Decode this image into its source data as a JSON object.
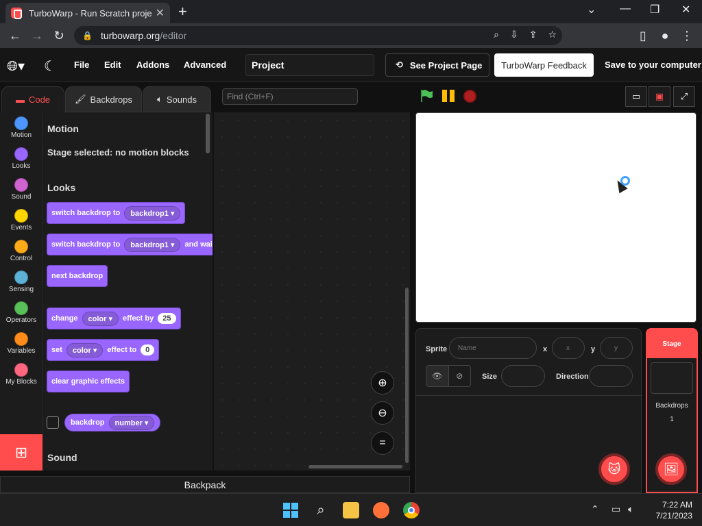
{
  "browser": {
    "tab_title": "TurboWarp - Run Scratch projects",
    "url_host": "turbowarp.org",
    "url_path": "/editor"
  },
  "menubar": {
    "file": "File",
    "edit": "Edit",
    "addons": "Addons",
    "advanced": "Advanced",
    "project_title": "Project",
    "see_project_page": "See Project Page",
    "feedback": "TurboWarp Feedback",
    "save": "Save to your computer"
  },
  "editor_tabs": {
    "code": "Code",
    "backdrops": "Backdrops",
    "sounds": "Sounds"
  },
  "find": {
    "placeholder": "Find (Ctrl+F)"
  },
  "categories": [
    {
      "label": "Motion",
      "color": "#4c97ff"
    },
    {
      "label": "Looks",
      "color": "#9966ff"
    },
    {
      "label": "Sound",
      "color": "#cf63cf"
    },
    {
      "label": "Events",
      "color": "#ffd500"
    },
    {
      "label": "Control",
      "color": "#ffab19"
    },
    {
      "label": "Sensing",
      "color": "#5cb1d6"
    },
    {
      "label": "Operators",
      "color": "#59c059"
    },
    {
      "label": "Variables",
      "color": "#ff8c1a"
    },
    {
      "label": "My Blocks",
      "color": "#ff6680"
    }
  ],
  "flyout": {
    "motion_head": "Motion",
    "motion_note": "Stage selected: no motion blocks",
    "looks_head": "Looks",
    "sound_head": "Sound",
    "blocks": {
      "switch_backdrop": "switch backdrop to",
      "backdrop1": "backdrop1",
      "and_wait": "and wait",
      "next_backdrop": "next backdrop",
      "change": "change",
      "color": "color",
      "effect_by": "effect by",
      "effect_by_value": "25",
      "set": "set",
      "effect_to": "effect to",
      "effect_to_value": "0",
      "clear_effects": "clear graphic effects",
      "backdrop": "backdrop",
      "number": "number"
    }
  },
  "backpack": "Backpack",
  "sprite_info": {
    "sprite_label": "Sprite",
    "name_placeholder": "Name",
    "x_label": "x",
    "x_placeholder": "x",
    "y_label": "y",
    "y_placeholder": "y",
    "size_label": "Size",
    "direction_label": "Direction"
  },
  "stage_pane": {
    "header": "Stage",
    "backdrops_label": "Backdrops",
    "backdrops_count": "1"
  },
  "taskbar": {
    "time": "7:22 AM",
    "date": "7/21/2023"
  },
  "colors": {
    "accent": "#ff4c4c",
    "looks": "#9966ff",
    "flag": "#4cbf56",
    "pause": "#ffbf00",
    "stop": "#b01f1f"
  }
}
